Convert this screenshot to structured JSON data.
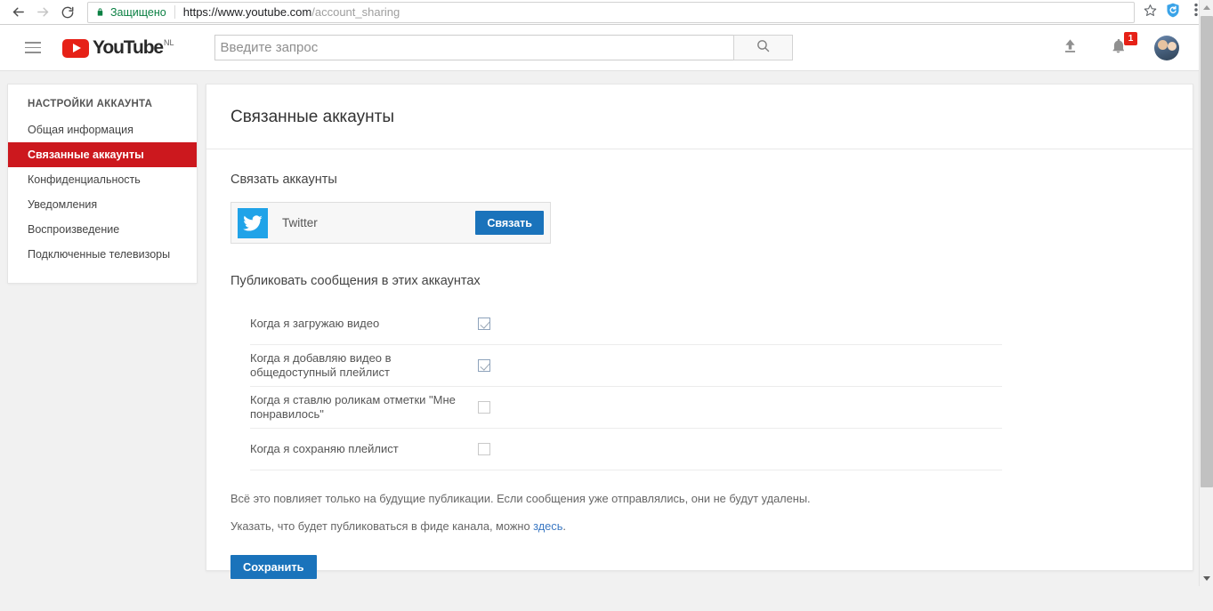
{
  "browser": {
    "back_icon": "back-arrow-icon",
    "forward_icon": "forward-arrow-icon",
    "reload_icon": "reload-icon",
    "security_label": "Защищено",
    "url_host": "https://www.youtube.com",
    "url_path": "/account_sharing",
    "bookmark_icon": "star-icon",
    "extension_icon": "shield-extension-icon",
    "menu_icon": "three-dot-menu-icon"
  },
  "masthead": {
    "menu_icon": "hamburger-menu-icon",
    "logo_word": "YouTube",
    "logo_country": "NL",
    "search_placeholder": "Введите запрос",
    "search_value": "",
    "search_icon": "search-icon",
    "upload_icon": "upload-icon",
    "notifications_icon": "bell-icon",
    "notifications_count": "1",
    "avatar": "user-avatar"
  },
  "sidebar": {
    "heading": "НАСТРОЙКИ АККАУНТА",
    "items": [
      {
        "label": "Общая информация",
        "active": false
      },
      {
        "label": "Связанные аккаунты",
        "active": true
      },
      {
        "label": "Конфиденциальность",
        "active": false
      },
      {
        "label": "Уведомления",
        "active": false
      },
      {
        "label": "Воспроизведение",
        "active": false
      },
      {
        "label": "Подключенные телевизоры",
        "active": false
      }
    ]
  },
  "main": {
    "title": "Связанные аккаунты",
    "link_section_title": "Связать аккаунты",
    "accounts": [
      {
        "name": "Twitter",
        "icon": "twitter-bird-icon",
        "button_label": "Связать"
      }
    ],
    "publish_section_title": "Публиковать сообщения в этих аккаунтах",
    "options": [
      {
        "label": "Когда я загружаю видео",
        "checked": true
      },
      {
        "label": "Когда я добавляю видео в общедоступный плейлист",
        "checked": true
      },
      {
        "label": "Когда я ставлю роликам отметки \"Мне понравилось\"",
        "checked": false
      },
      {
        "label": "Когда я сохраняю плейлист",
        "checked": false
      }
    ],
    "note_one": "Всё это повлияет только на будущие публикации. Если сообщения уже отправлялись, они не будут удалены.",
    "note_two_before": "Указать, что будет публиковаться в фиде канала, можно ",
    "note_two_link": "здесь",
    "note_two_after": ".",
    "save_label": "Сохранить"
  },
  "colors": {
    "brand_red": "#cc181e",
    "youtube_red": "#e62117",
    "twitter_blue": "#20a3e8",
    "button_blue": "#1a73bb",
    "link_blue": "#3b78c3",
    "secure_green": "#0b8043"
  }
}
